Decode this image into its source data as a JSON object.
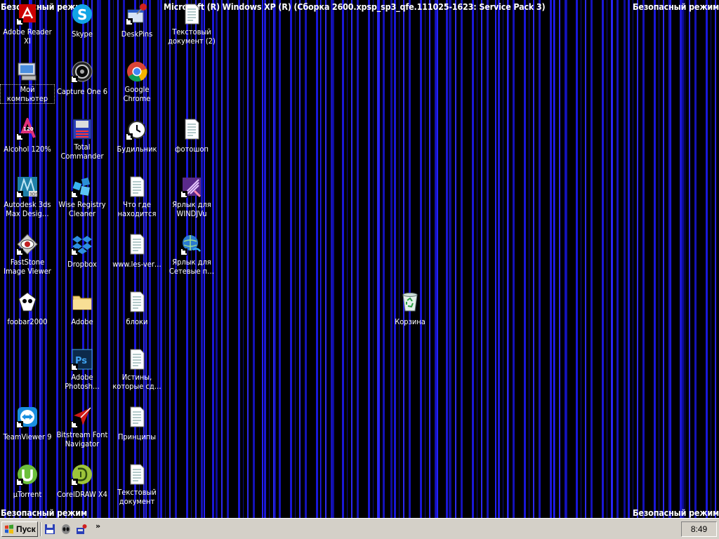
{
  "safe_mode_label": "Безопасный режим",
  "os_banner": "Microsoft (R) Windows XP (R) (Сборка 2600.xpsp_sp3_qfe.111025-1623: Service Pack 3)",
  "desktop_icons": [
    {
      "label": "Adobe Reader XI",
      "icon": "adobe-reader-icon"
    },
    {
      "label": "Skype",
      "icon": "skype-icon"
    },
    {
      "label": "DeskPins",
      "icon": "deskpins-icon"
    },
    {
      "label": "Текстовый документ (2)",
      "icon": "text-document-icon"
    },
    {
      "label": "Мой компьютер",
      "icon": "my-computer-icon"
    },
    {
      "label": "Capture One 6",
      "icon": "capture-one-icon"
    },
    {
      "label": "Google Chrome",
      "icon": "chrome-icon"
    },
    {
      "label": "Alcohol 120%",
      "icon": "alcohol-icon"
    },
    {
      "label": "Total Commander",
      "icon": "total-commander-icon"
    },
    {
      "label": "Будильник",
      "icon": "alarm-clock-icon"
    },
    {
      "label": "фотошоп",
      "icon": "text-document-icon"
    },
    {
      "label": "Autodesk 3ds Max Desig…",
      "icon": "3ds-max-icon"
    },
    {
      "label": "Wise Registry Cleaner",
      "icon": "wise-registry-icon"
    },
    {
      "label": "Что где находится",
      "icon": "text-document-icon"
    },
    {
      "label": "Ярлык для WINDJVu",
      "icon": "windjvu-icon"
    },
    {
      "label": "FastStone Image Viewer",
      "icon": "faststone-icon"
    },
    {
      "label": "Dropbox",
      "icon": "dropbox-icon"
    },
    {
      "label": "www.les-ver…",
      "icon": "text-document-icon"
    },
    {
      "label": "Ярлык для Сетевые п…",
      "icon": "network-icon"
    },
    {
      "label": "foobar2000",
      "icon": "foobar-icon"
    },
    {
      "label": "Adobe",
      "icon": "folder-icon"
    },
    {
      "label": "блоки",
      "icon": "text-document-icon"
    },
    {
      "label": "Корзина",
      "icon": "recycle-bin-icon"
    },
    {
      "label": "Adobe Photosh…",
      "icon": "photoshop-icon"
    },
    {
      "label": "Истины, которые сд…",
      "icon": "text-document-icon"
    },
    {
      "label": "TeamViewer 9",
      "icon": "teamviewer-icon"
    },
    {
      "label": "Bitstream Font Navigator",
      "icon": "bitstream-icon"
    },
    {
      "label": "Принципы",
      "icon": "text-document-icon"
    },
    {
      "label": "µTorrent",
      "icon": "utorrent-icon"
    },
    {
      "label": "CorelDRAW X4",
      "icon": "coreldraw-icon"
    },
    {
      "label": "Текстовый документ",
      "icon": "text-document-icon"
    }
  ],
  "taskbar": {
    "start_label": "Пуск",
    "quick_launch": [
      "save-icon",
      "alien-icon",
      "tool-icon"
    ],
    "overflow_label": "»",
    "clock": "8:49"
  }
}
